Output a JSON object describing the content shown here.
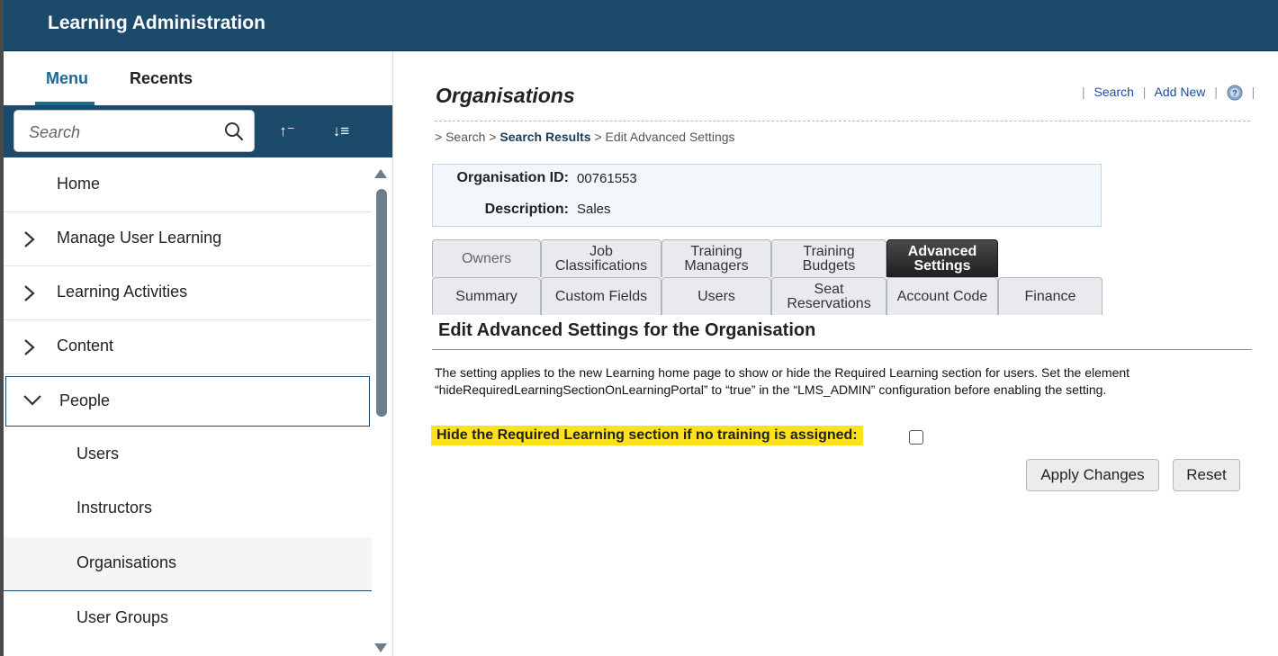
{
  "app": {
    "title": "Learning Administration"
  },
  "sidebar": {
    "tabs": [
      {
        "label": "Menu"
      },
      {
        "label": "Recents"
      }
    ],
    "search": {
      "placeholder": "Search"
    },
    "sort_ascending_label": "↑⁻",
    "sort_descending_label": "↓≡",
    "items": [
      {
        "label": "Home"
      },
      {
        "label": "Manage User Learning"
      },
      {
        "label": "Learning Activities"
      },
      {
        "label": "Content"
      },
      {
        "label": "People"
      },
      {
        "label": "Users"
      },
      {
        "label": "Instructors"
      },
      {
        "label": "Organisations"
      },
      {
        "label": "User Groups"
      }
    ]
  },
  "main": {
    "page_title": "Organisations",
    "top_links": {
      "search": "Search",
      "add_new": "Add New",
      "sep": "|"
    },
    "breadcrumb": {
      "prefix1": ">",
      "search": "Search",
      "prefix2": ">",
      "search_results": "Search Results",
      "prefix3": ">",
      "current": "Edit Advanced Settings"
    },
    "org": {
      "id_label": "Organisation ID:",
      "id_value": "00761553",
      "desc_label": "Description:",
      "desc_value": "Sales"
    },
    "tabs_row1": [
      {
        "label": "Owners"
      },
      {
        "label": "Job Classifications"
      },
      {
        "label": "Training Managers"
      },
      {
        "label": "Training Budgets"
      },
      {
        "label": "Advanced Settings"
      }
    ],
    "tabs_row2": [
      {
        "label": "Summary"
      },
      {
        "label": "Custom Fields"
      },
      {
        "label": "Users"
      },
      {
        "label": "Seat Reservations"
      },
      {
        "label": "Account Code"
      },
      {
        "label": "Finance"
      }
    ],
    "section_title": "Edit Advanced Settings for the Organisation",
    "description_line1": "The setting applies to the new Learning home page to show or hide the Required Learning section for users. Set the element",
    "description_line2": "“hideRequiredLearningSectionOnLearningPortal” to “true” in the “LMS_ADMIN” configuration before enabling the setting.",
    "setting_label": "Hide the Required Learning section if no training is assigned:",
    "setting_checked": false,
    "buttons": {
      "apply": "Apply Changes",
      "reset": "Reset"
    }
  },
  "colors": {
    "header": "#1b4a6b",
    "accent": "#1a6a96",
    "highlight": "#fde21b",
    "link": "#1a4fa0"
  }
}
